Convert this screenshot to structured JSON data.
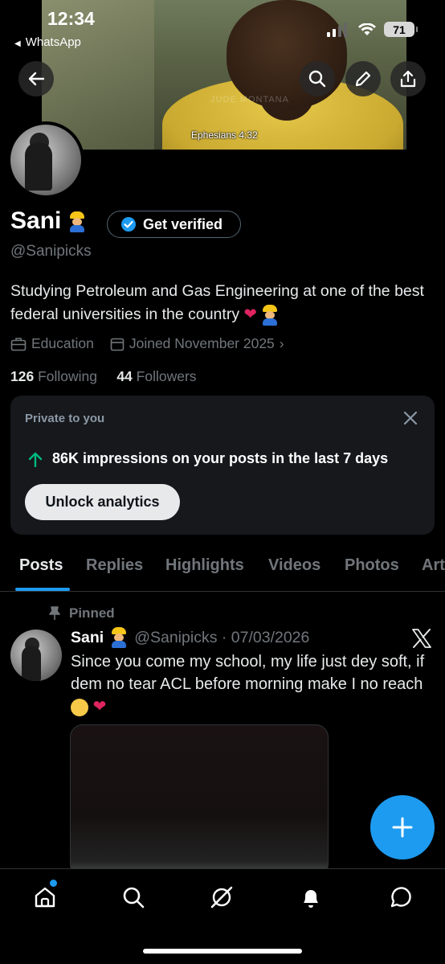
{
  "status_bar": {
    "time": "12:34",
    "back_app": "WhatsApp",
    "battery": "71"
  },
  "banner": {
    "caption": "Ephesians 4:32",
    "watermark": "JUDE MONTANA"
  },
  "profile": {
    "name": "Sani",
    "verify_label": "Get verified",
    "handle": "@Sanipicks",
    "bio": "Studying Petroleum and Gas Engineering at one of the best federal universities in the country",
    "category": "Education",
    "joined": "Joined November 2025",
    "following_count": "126",
    "following_label": "Following",
    "followers_count": "44",
    "followers_label": "Followers"
  },
  "private_card": {
    "title": "Private to you",
    "impressions_text": "86K impressions on your posts in the last 7 days",
    "unlock_label": "Unlock analytics"
  },
  "tabs": [
    "Posts",
    "Replies",
    "Highlights",
    "Videos",
    "Photos",
    "Art"
  ],
  "post": {
    "pinned_label": "Pinned",
    "author": "Sani",
    "handle_date": "@Sanipicks · 07/03/2026",
    "text": "Since you come my school, my life just dey soft, if dem no tear ACL before morning make I no reach"
  },
  "colors": {
    "accent": "#1d9bf0",
    "background": "#000000",
    "muted": "#71767b"
  }
}
